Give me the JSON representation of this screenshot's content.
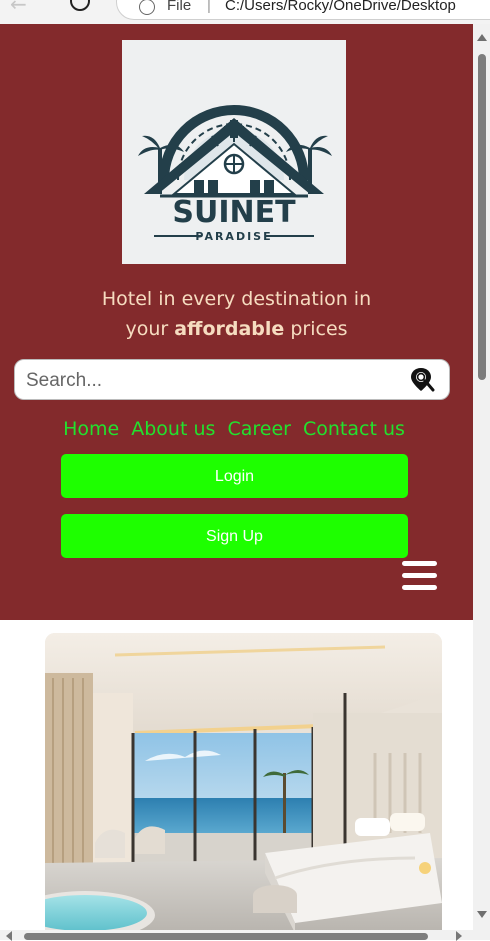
{
  "browser": {
    "scheme_label": "File",
    "separator": "|",
    "address": "C:/Users/Rocky/OneDrive/Desktop"
  },
  "header": {
    "logo": {
      "brand_name": "SUINET",
      "brand_sub": "PARADISE"
    },
    "tagline": {
      "line1": "Hotel in every destination in",
      "line2_before": "your",
      "line2_bold": "affordable",
      "line2_after": "prices"
    },
    "search": {
      "placeholder": "Search...",
      "icon": "search-location-icon"
    },
    "nav": {
      "items": [
        "Home",
        "About us",
        "Career",
        "Contact us"
      ]
    },
    "buttons": {
      "login": "Login",
      "signup": "Sign Up"
    },
    "menu_icon": "hamburger-menu-icon"
  },
  "hero": {
    "image": "hotel-bedroom-ocean-view"
  },
  "colors": {
    "header_bg": "#832a2c",
    "tagline_text": "#f6dcc0",
    "nav_link": "#22e12e",
    "button_bg": "#1eff00",
    "button_text": "#ffffff"
  }
}
